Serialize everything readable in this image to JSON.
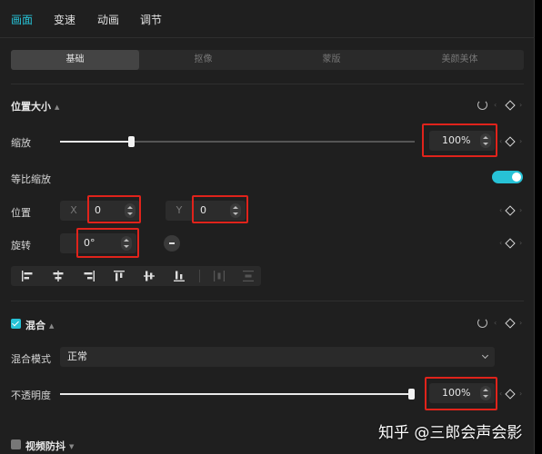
{
  "top_tabs": [
    "画面",
    "变速",
    "动画",
    "调节"
  ],
  "sub_tabs": [
    "基础",
    "抠像",
    "蒙版",
    "美颜美体"
  ],
  "position_size": {
    "title": "位置大小",
    "scale_label": "缩放",
    "scale_value": "100%",
    "scale_fraction": 0.2,
    "uniform_scale_label": "等比缩放",
    "uniform_scale_on": true,
    "position_label": "位置",
    "x_label": "X",
    "x_value": "0",
    "y_label": "Y",
    "y_value": "0",
    "rotate_label": "旋转",
    "rotate_value": "0°",
    "align_icons": [
      "align-left-icon",
      "align-center-h-icon",
      "align-right-icon",
      "align-top-icon",
      "align-center-v-icon",
      "align-bottom-icon",
      "distribute-h-icon",
      "distribute-v-icon"
    ]
  },
  "blend": {
    "title": "混合",
    "enabled": true,
    "mode_label": "混合模式",
    "mode_value": "正常",
    "opacity_label": "不透明度",
    "opacity_value": "100%",
    "opacity_fraction": 1.0
  },
  "stabilize": {
    "title": "视频防抖",
    "enabled": false
  },
  "watermark": "知乎 @三郎会声会影",
  "colors": {
    "accent": "#27c2d6",
    "highlight": "#e0231b"
  }
}
